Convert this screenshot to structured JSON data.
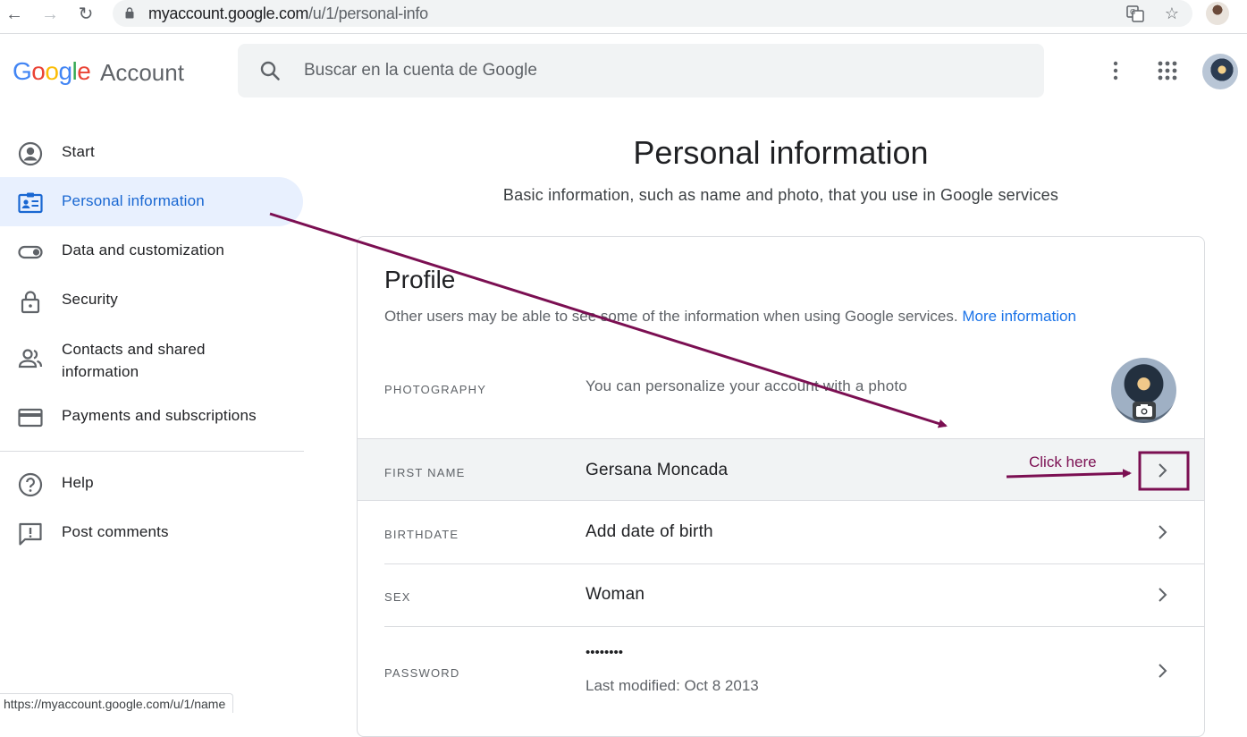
{
  "browser": {
    "url_host": "myaccount.google.com",
    "url_path": "/u/1/personal-info"
  },
  "header": {
    "logo_letters": [
      "G",
      "o",
      "o",
      "g",
      "l",
      "e"
    ],
    "logo_colors": [
      "#4285F4",
      "#EA4335",
      "#FBBC05",
      "#4285F4",
      "#34A853",
      "#EA4335"
    ],
    "product": "Account",
    "search_placeholder": "Buscar en la cuenta de Google"
  },
  "sidebar": {
    "items": [
      {
        "label": "Start",
        "icon": "account-circle-icon"
      },
      {
        "label": "Personal information",
        "icon": "id-card-icon",
        "active": true
      },
      {
        "label": "Data and customization",
        "icon": "toggle-icon"
      },
      {
        "label": "Security",
        "icon": "lock-icon"
      },
      {
        "label": "Contacts and shared\ninformation",
        "icon": "people-icon"
      },
      {
        "label": "Payments and subscriptions",
        "icon": "credit-card-icon"
      },
      {
        "label": "Help",
        "icon": "help-icon"
      },
      {
        "label": "Post comments",
        "icon": "feedback-icon"
      }
    ]
  },
  "main": {
    "title": "Personal information",
    "subtitle": "Basic information, such as name and photo, that you use in Google services",
    "profile": {
      "title": "Profile",
      "description": "Other users may be able to see some of the information when using Google services.",
      "more_link": "More information",
      "rows": {
        "photo": {
          "label": "PHOTOGRAPHY",
          "value": "You can personalize your account with a photo"
        },
        "first_name": {
          "label": "FIRST NAME",
          "value": "Gersana Moncada"
        },
        "birthdate": {
          "label": "BIRTHDATE",
          "value": "Add date of birth"
        },
        "sex": {
          "label": "SEX",
          "value": "Woman"
        },
        "password": {
          "label": "PASSWORD",
          "value": "••••••••",
          "sub": "Last modified: Oct 8 2013"
        }
      }
    }
  },
  "annotation": {
    "callout_text": "Click here",
    "color": "#7b0f52"
  },
  "status_bar": {
    "url": "https://myaccount.google.com/u/1/name"
  }
}
